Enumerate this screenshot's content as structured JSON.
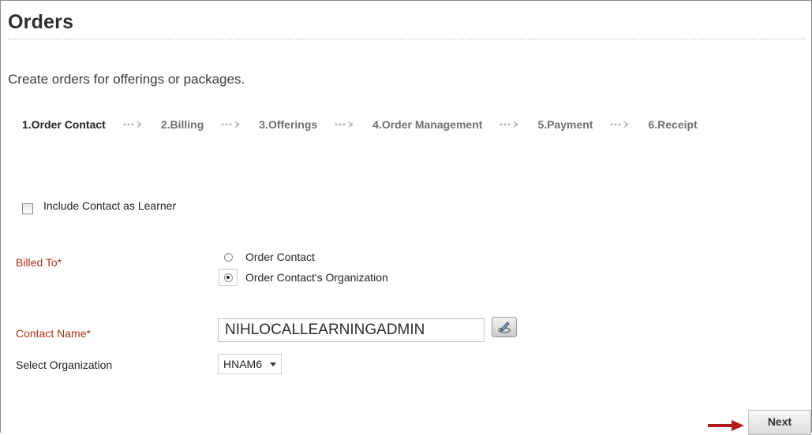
{
  "page": {
    "title": "Orders",
    "subtitle": "Create orders for offerings or packages."
  },
  "steps": [
    {
      "label": "1.Order Contact",
      "active": true
    },
    {
      "label": "2.Billing",
      "active": false
    },
    {
      "label": "3.Offerings",
      "active": false
    },
    {
      "label": "4.Order Management",
      "active": false
    },
    {
      "label": "5.Payment",
      "active": false
    },
    {
      "label": "6.Receipt",
      "active": false
    }
  ],
  "include_learner": {
    "label": "Include Contact as Learner",
    "checked": false
  },
  "billed_to": {
    "label": "Billed To*",
    "options": [
      {
        "label": "Order Contact",
        "selected": false
      },
      {
        "label": "Order Contact's Organization",
        "selected": true
      }
    ]
  },
  "contact_name": {
    "label": "Contact Name*",
    "value": "NIHLOCALLEARNINGADMIN"
  },
  "organization": {
    "label": "Select Organization",
    "selected": "HNAM6"
  },
  "actions": {
    "next_label": "Next"
  },
  "colors": {
    "required_label": "#a8321b",
    "arrow": "#b01c1c"
  },
  "icons": {
    "step_separator": "dotted-chevron-right-icon",
    "lookup": "edit-pencil-icon",
    "next_pointer": "red-arrow-right-icon"
  }
}
